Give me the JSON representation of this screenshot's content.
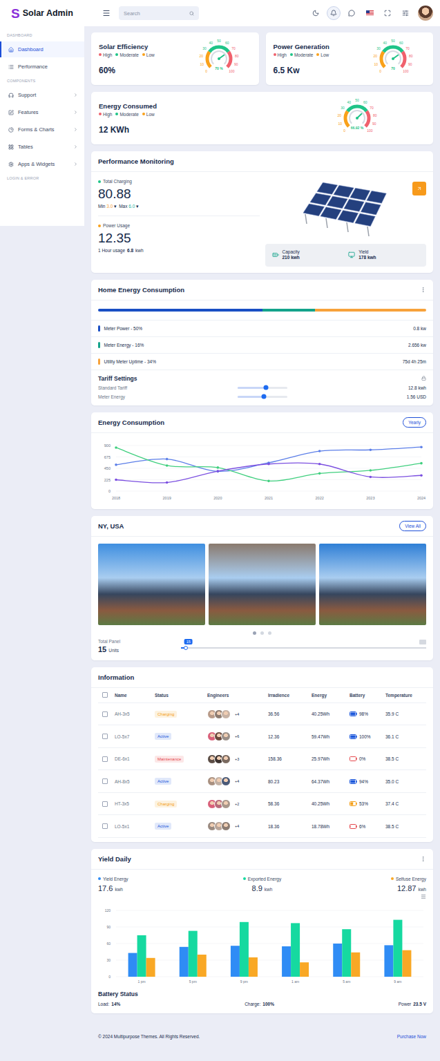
{
  "header": {
    "logo": {
      "mark": "S",
      "title": "Solar Admin"
    },
    "search": {
      "placeholder": "Search"
    }
  },
  "sidebar": {
    "sections": [
      {
        "label": "DASHBOARD",
        "items": [
          {
            "label": "Dashboard",
            "selected": true,
            "has_submenu": false
          },
          {
            "label": "Performance",
            "selected": false,
            "has_submenu": false
          }
        ]
      },
      {
        "label": "COMPONENTS",
        "items": [
          {
            "label": "Support",
            "selected": false,
            "has_submenu": true
          },
          {
            "label": "Features",
            "selected": false,
            "has_submenu": true
          },
          {
            "label": "Forms & Charts",
            "selected": false,
            "has_submenu": true
          },
          {
            "label": "Tables",
            "selected": false,
            "has_submenu": true
          },
          {
            "label": "Apps & Widgets",
            "selected": false,
            "has_submenu": true
          }
        ]
      },
      {
        "label": "LOGIN & ERROR",
        "items": []
      }
    ]
  },
  "legend": [
    {
      "label": "High",
      "color": "#f0616d"
    },
    {
      "label": "Moderate",
      "color": "#1fc488"
    },
    {
      "label": "Low",
      "color": "#f9a11b"
    }
  ],
  "gauges": [
    {
      "title": "Solar Efficiency",
      "value": "60%",
      "reading": "70 %",
      "level": 0.7,
      "wide": false,
      "ticks": [
        "0",
        "10",
        "20",
        "30",
        "40",
        "50",
        "60",
        "70",
        "80",
        "90",
        "100"
      ]
    },
    {
      "title": "Power Generation",
      "value": "6.5 Kw",
      "reading": "70",
      "level": 0.7,
      "wide": false,
      "ticks": [
        "0",
        "10",
        "20",
        "30",
        "40",
        "50",
        "60",
        "70",
        "80",
        "90",
        "100"
      ]
    },
    {
      "title": "Energy Consumed",
      "value": "12 KWh",
      "reading": "66.92 %",
      "level": 0.6692,
      "wide": true,
      "ticks": [
        "0",
        "10",
        "20",
        "30",
        "40",
        "50",
        "60",
        "70",
        "80",
        "90",
        "100"
      ]
    }
  ],
  "performance": {
    "title": "Performance Monitoring",
    "charging": {
      "label": "Total Charging",
      "color": "#1fc488",
      "value": "80.88",
      "range": [
        {
          "label": "Min",
          "value": "3.0",
          "caret": "▾",
          "color": "#f7a23b"
        },
        {
          "label": "Max",
          "value": "6.0",
          "caret": "▾",
          "color": "#1fb3a0"
        }
      ]
    },
    "usage": {
      "label": "Power Usage",
      "color": "#f9a11b",
      "value": "12.35",
      "note": "1 Hour usage",
      "note_value": "6.8",
      "note_unit": "kwh"
    },
    "stats": [
      {
        "label": "Capacity",
        "value": "210 kwh"
      },
      {
        "label": "Yield",
        "value": "178 kwh"
      }
    ]
  },
  "home": {
    "title": "Home Energy Consumption",
    "meters": [
      {
        "label": "Meter Power - 50%",
        "value": "0.8 kw",
        "level": 0.5,
        "color": "#1a4fc4"
      },
      {
        "label": "Meter Energy - 16%",
        "value": "2.656 kw",
        "level": 0.16,
        "color": "#14a38b"
      },
      {
        "label": "Utility Meter Uptime - 34%",
        "value": "75d 4h 25m",
        "level": 0.34,
        "color": "#f7a23b"
      }
    ],
    "tariff": {
      "title": "Tariff Settings",
      "sliders": [
        {
          "label": "Standard Tariff",
          "value": "12.8 kwh",
          "level": 0.58
        },
        {
          "label": "Meter Energy",
          "value": "1.56 USD",
          "level": 0.54
        }
      ]
    }
  },
  "consumption": {
    "title": "Energy Consumption",
    "range_button": "Yearly",
    "y_ticks": [
      "0",
      "225",
      "450",
      "675",
      "900"
    ],
    "x_labels": [
      "2018",
      "2019",
      "2020",
      "2021",
      "2022",
      "2023",
      "2024"
    ],
    "series": [
      {
        "color": "#5b7ee8",
        "values": [
          520,
          633,
          390,
          560,
          790,
          815,
          870
        ]
      },
      {
        "color": "#3fcf7e",
        "values": [
          860,
          505,
          465,
          200,
          350,
          410,
          550
        ]
      },
      {
        "color": "#7b4fe0",
        "values": [
          225,
          170,
          395,
          535,
          535,
          280,
          310
        ]
      }
    ]
  },
  "gallery": {
    "title": "NY, USA",
    "button": "View All",
    "photos": [
      {
        "color": "#3f8fe0"
      },
      {
        "color": "#8a7a6e"
      },
      {
        "color": "#2f7fd6"
      }
    ],
    "dots": [
      {
        "selected": true
      },
      {
        "selected": false
      },
      {
        "selected": false
      }
    ],
    "panel": {
      "label": "Total Panel",
      "value": "15",
      "unit": "Units",
      "slider_value": "15",
      "level": 0.02
    }
  },
  "table": {
    "title": "Information",
    "header_checked": false,
    "columns": [
      "Name",
      "Status",
      "Engineers",
      "Irradience",
      "Energy",
      "Battery",
      "Temperature"
    ],
    "rows": [
      {
        "checked": false,
        "name": "AH-3x5",
        "status": {
          "label": "Charging",
          "color": "#f39c12"
        },
        "engineers": {
          "avatars": [
            "#b89a88",
            "#8d7b70",
            "#c7b2a4"
          ],
          "more": "+4"
        },
        "irradience": "36.56",
        "energy": "40.25Wh",
        "battery": {
          "reading": "98%",
          "level": 0.98,
          "color": "#1a56db"
        },
        "temperature": "35.9 C"
      },
      {
        "checked": false,
        "name": "LO-5x7",
        "status": {
          "label": "Active",
          "color": "#1a56db"
        },
        "engineers": {
          "avatars": [
            "#d9607a",
            "#6b4a3e",
            "#9a8f88"
          ],
          "more": "+6"
        },
        "irradience": "12.36",
        "energy": "59.47Wh",
        "battery": {
          "reading": "100%",
          "level": 1,
          "color": "#1a56db"
        },
        "temperature": "36.1 C"
      },
      {
        "checked": false,
        "name": "DE-6x1",
        "status": {
          "label": "Maintenance",
          "color": "#e5484d"
        },
        "engineers": {
          "avatars": [
            "#5b4d45",
            "#3d3330",
            "#7a6a60"
          ],
          "more": "+3"
        },
        "irradience": "158.36",
        "energy": "25.97Wh",
        "battery": {
          "reading": "0%",
          "level": 0,
          "color": "#e5484d"
        },
        "temperature": "38.5 C"
      },
      {
        "checked": false,
        "name": "AH-8x5",
        "status": {
          "label": "Active",
          "color": "#1a56db"
        },
        "engineers": {
          "avatars": [
            "#a89080",
            "#c2b0a3",
            "#4a5a78"
          ],
          "more": "+4"
        },
        "irradience": "80.23",
        "energy": "64.37Wh",
        "battery": {
          "reading": "94%",
          "level": 0.94,
          "color": "#1a56db"
        },
        "temperature": "35.0 C"
      },
      {
        "checked": false,
        "name": "HT-3x5",
        "status": {
          "label": "Charging",
          "color": "#f39c12"
        },
        "engineers": {
          "avatars": [
            "#d9607a",
            "#b86a7a",
            "#a8968a"
          ],
          "more": "+2"
        },
        "irradience": "58.36",
        "energy": "40.25Wh",
        "battery": {
          "reading": "53%",
          "level": 0.53,
          "color": "#f39c12"
        },
        "temperature": "37.4 C"
      },
      {
        "checked": false,
        "name": "LO-5x1",
        "status": {
          "label": "Active",
          "color": "#1a56db"
        },
        "engineers": {
          "avatars": [
            "#9a8a80",
            "#b8a498",
            "#8c7c72"
          ],
          "more": "+4"
        },
        "irradience": "18.36",
        "energy": "18.78Wh",
        "battery": {
          "reading": "6%",
          "level": 0.06,
          "color": "#e5484d"
        },
        "temperature": "38.5 C"
      }
    ]
  },
  "yield": {
    "title": "Yield Daily",
    "legend": [
      {
        "label": "Yield Energy",
        "value": "17.6",
        "unit": "kwh",
        "color": "#2f8cf5",
        "values": [
          43,
          54,
          56,
          55,
          60,
          57
        ]
      },
      {
        "label": "Exported Energy",
        "value": "8.9",
        "unit": "kwh",
        "color": "#16d9a0",
        "values": [
          75,
          83,
          99,
          97,
          86,
          103
        ]
      },
      {
        "label": "Selfuse Energy",
        "value": "12.87",
        "unit": "kwh",
        "color": "#f9a825",
        "values": [
          34,
          40,
          35,
          26,
          44,
          48
        ]
      }
    ],
    "y_ticks": [
      "0",
      "30",
      "60",
      "90",
      "120"
    ],
    "x_labels": [
      "1 pm",
      "5 pm",
      "9 pm",
      "1 am",
      "5 am",
      "9 am"
    ]
  },
  "battery_status": {
    "title": "Battery Status",
    "items": [
      {
        "label": "Load:",
        "value": "14%"
      },
      {
        "label": "Charge:",
        "value": "100%"
      },
      {
        "label": "Power",
        "value": "23.5 V"
      }
    ]
  },
  "footer": {
    "copyright": "© 2024 Multipurpose Themes. All Rights Reserved.",
    "link": "Purchase Now"
  }
}
